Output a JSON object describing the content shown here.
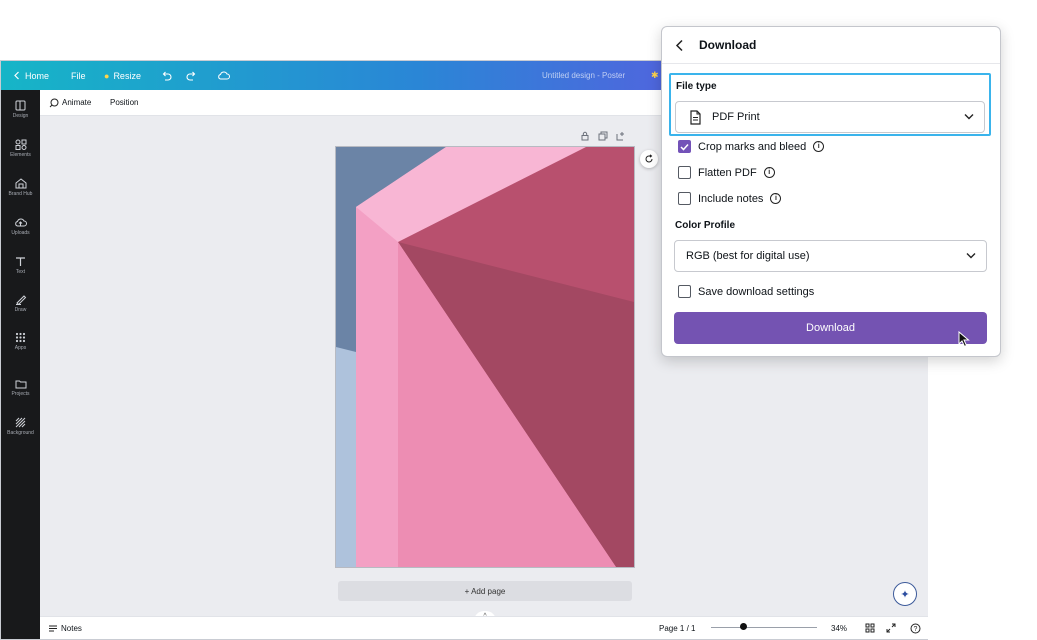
{
  "topbar": {
    "home": "Home",
    "file": "File",
    "resize": "Resize",
    "document_title": "Untitled design - Poster"
  },
  "sidebar": {
    "items": [
      {
        "label": "Design",
        "icon": "layout-icon"
      },
      {
        "label": "Elements",
        "icon": "shapes-icon"
      },
      {
        "label": "Brand Hub",
        "icon": "brand-icon"
      },
      {
        "label": "Uploads",
        "icon": "upload-cloud-icon"
      },
      {
        "label": "Text",
        "icon": "text-icon"
      },
      {
        "label": "Draw",
        "icon": "draw-icon"
      },
      {
        "label": "Apps",
        "icon": "grid-icon"
      },
      {
        "label": "Projects",
        "icon": "folder-icon"
      },
      {
        "label": "Background",
        "icon": "pattern-icon"
      }
    ]
  },
  "context_toolbar": {
    "animate": "Animate",
    "position": "Position"
  },
  "canvas": {
    "add_page": "+ Add page"
  },
  "bottombar": {
    "notes": "Notes",
    "page_indicator": "Page 1 / 1",
    "zoom": "34%",
    "zoom_level": 0.34
  },
  "download_panel": {
    "title": "Download",
    "file_type_label": "File type",
    "file_type_value": "PDF Print",
    "options": [
      {
        "label": "Crop marks and bleed",
        "checked": true,
        "info": true
      },
      {
        "label": "Flatten PDF",
        "checked": false,
        "info": true
      },
      {
        "label": "Include notes",
        "checked": false,
        "info": true
      }
    ],
    "color_profile_label": "Color Profile",
    "color_profile_value": "RGB (best for digital use)",
    "save_settings_label": "Save download settings",
    "save_settings_checked": false,
    "download_button": "Download"
  },
  "colors": {
    "accent": "#7453b2",
    "focus_ring": "#3ab4ec",
    "topbar_start": "#16b5c7",
    "topbar_end": "#7a4fe0",
    "sidebar_bg": "#18191b"
  }
}
